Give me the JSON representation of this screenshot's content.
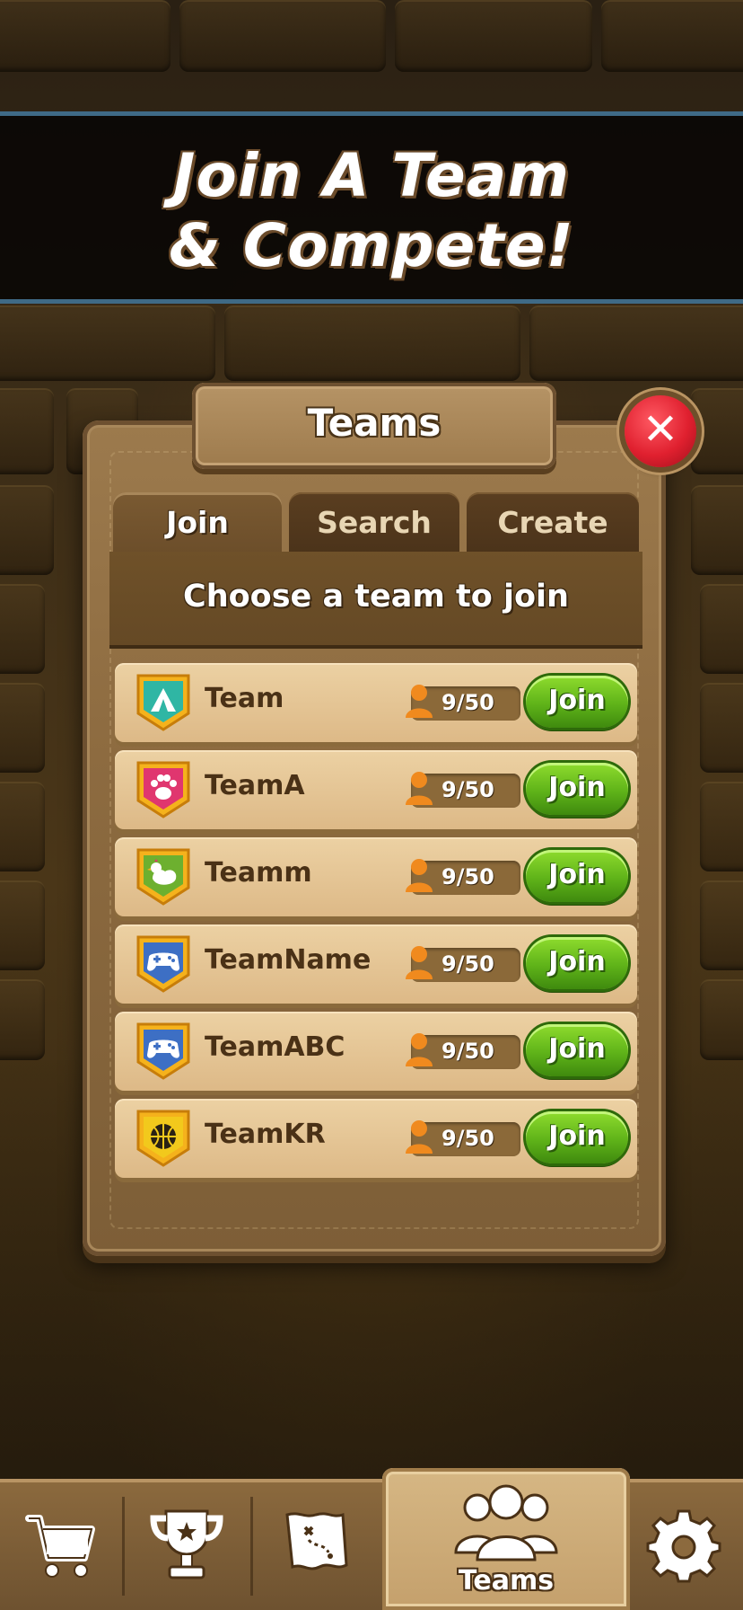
{
  "banner": {
    "line1": "Join A Team",
    "line2": "& Compete!"
  },
  "dialog": {
    "title": "Teams",
    "close_icon": "close-icon",
    "tabs": [
      {
        "label": "Join",
        "active": true
      },
      {
        "label": "Search",
        "active": false
      },
      {
        "label": "Create",
        "active": false
      }
    ],
    "header": "Choose a team to join",
    "teams": [
      {
        "name": "Team",
        "members": "9/50",
        "badge_icon": "tent-icon",
        "badge_color": "#2fb6a4",
        "join_label": "Join"
      },
      {
        "name": "TeamA",
        "members": "9/50",
        "badge_icon": "paw-icon",
        "badge_color": "#e0366f",
        "join_label": "Join"
      },
      {
        "name": "Teamm",
        "members": "9/50",
        "badge_icon": "chicken-icon",
        "badge_color": "#6db02f",
        "join_label": "Join"
      },
      {
        "name": "TeamName",
        "members": "9/50",
        "badge_icon": "gamepad-icon",
        "badge_color": "#3d6fc4",
        "join_label": "Join"
      },
      {
        "name": "TeamABC",
        "members": "9/50",
        "badge_icon": "gamepad-icon",
        "badge_color": "#3d6fc4",
        "join_label": "Join"
      },
      {
        "name": "TeamKR",
        "members": "9/50",
        "badge_icon": "basketball-icon",
        "badge_color": "#f2c91c",
        "join_label": "Join"
      }
    ]
  },
  "bottom_nav": {
    "items": [
      {
        "name": "shop",
        "icon": "cart-icon"
      },
      {
        "name": "leaderboard",
        "icon": "trophy-icon"
      },
      {
        "name": "map",
        "icon": "treasure-map-icon"
      },
      {
        "name": "teams",
        "icon": "team-icon",
        "label": "Teams",
        "active": true
      },
      {
        "name": "settings",
        "icon": "gear-icon"
      }
    ]
  },
  "colors": {
    "join_green": "#5fb319",
    "close_red": "#e0202f",
    "banner_stripe": "#3f6a86",
    "member_orange": "#f08a1e"
  }
}
